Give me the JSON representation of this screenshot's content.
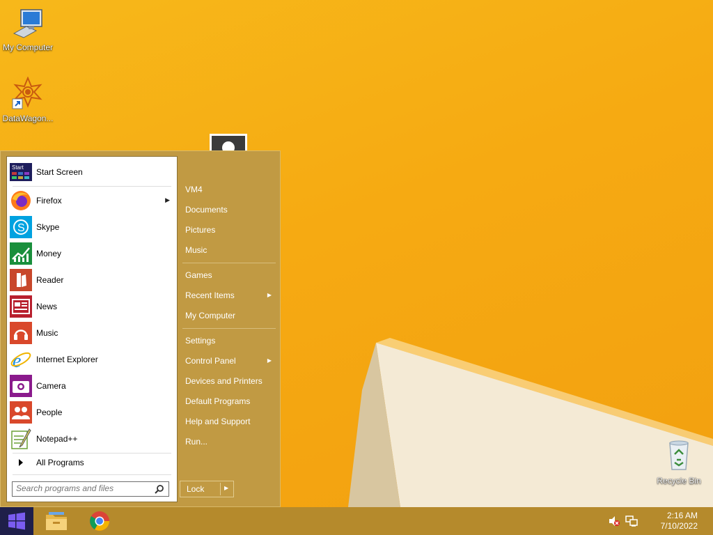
{
  "desktop": {
    "icons": [
      {
        "label": "My Computer",
        "icon": "computer-icon"
      },
      {
        "label": "DataWagon...",
        "icon": "datawagon-shortcut-icon"
      },
      {
        "label": "Recycle Bin",
        "icon": "recycle-bin-icon"
      }
    ]
  },
  "start_menu": {
    "programs": [
      {
        "label": "Start Screen",
        "icon": "start-screen-icon"
      },
      {
        "label": "Firefox",
        "icon": "firefox-icon",
        "has_submenu": true
      },
      {
        "label": "Skype",
        "icon": "skype-icon"
      },
      {
        "label": "Money",
        "icon": "money-icon"
      },
      {
        "label": "Reader",
        "icon": "reader-icon"
      },
      {
        "label": "News",
        "icon": "news-icon"
      },
      {
        "label": "Music",
        "icon": "music-icon"
      },
      {
        "label": "Internet Explorer",
        "icon": "internet-explorer-icon"
      },
      {
        "label": "Camera",
        "icon": "camera-icon"
      },
      {
        "label": "People",
        "icon": "people-icon"
      },
      {
        "label": "Notepad++",
        "icon": "notepad-plus-plus-icon"
      }
    ],
    "start_icon_text": "Start",
    "all_programs": "All Programs",
    "search_placeholder": "Search programs and files",
    "right_items": [
      {
        "label": "VM4"
      },
      {
        "label": "Documents"
      },
      {
        "label": "Pictures"
      },
      {
        "label": "Music"
      },
      {
        "label": "Games"
      },
      {
        "label": "Recent Items",
        "has_submenu": true
      },
      {
        "label": "My Computer"
      },
      {
        "label": "Settings"
      },
      {
        "label": "Control Panel",
        "has_submenu": true
      },
      {
        "label": "Devices and Printers"
      },
      {
        "label": "Default Programs"
      },
      {
        "label": "Help and Support"
      },
      {
        "label": "Run..."
      }
    ],
    "lock_label": "Lock"
  },
  "taskbar": {
    "pinned": [
      {
        "name": "File Explorer",
        "icon": "file-explorer-icon"
      },
      {
        "name": "Google Chrome",
        "icon": "chrome-icon"
      }
    ],
    "tray_icons": [
      "speaker-muted-icon",
      "network-icon"
    ],
    "time": "2:16 AM",
    "date": "7/10/2022"
  },
  "colors": {
    "wallpaper": "#f6aa12",
    "menu_background": "#c19a43",
    "taskbar": "#b58a2c",
    "start_button": "#1f1f4a"
  }
}
